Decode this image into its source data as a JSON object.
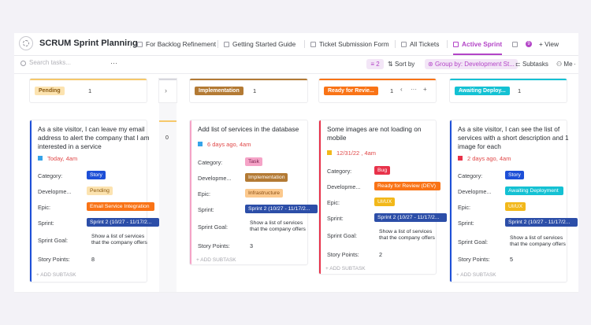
{
  "header": {
    "title": "SCRUM Sprint Planning",
    "tabs": [
      "For Backlog Refinement",
      "Getting Started Guide",
      "Ticket Submission Form",
      "All Tickets",
      "Active Sprint"
    ],
    "more_count": "9",
    "view_label": "+ View"
  },
  "toolbar": {
    "search_placeholder": "Search tasks...",
    "more": "···",
    "filter_count": "2",
    "sort_label": "Sort by",
    "group_label": "Group by: Development St...",
    "subtasks_label": "Subtasks",
    "me_label": "Me",
    "overflow": "·"
  },
  "colors": {
    "accent": "#b344c7",
    "pending": "#f6c86a",
    "implementation": "#b37a34",
    "ready": "#f97316",
    "awaiting": "#14c1d3",
    "story": "#1d4fd7",
    "bug": "#e8324a",
    "sprint": "#2c4ea8"
  },
  "columns": [
    {
      "name": "Pending",
      "count": "1"
    },
    {
      "name": "Implementation",
      "count": "1"
    },
    {
      "name": "Ready for Revie...",
      "count": "1"
    },
    {
      "name": "Awaiting Deploy...",
      "count": "1"
    }
  ],
  "collapsed_column": {
    "count": "0",
    "icon": "chevron-right-icon"
  },
  "labels": {
    "category": "Category:",
    "development": "Developme...",
    "epic": "Epic:",
    "sprint": "Sprint:",
    "sprint_goal": "Sprint Goal:",
    "story_points": "Story Points:",
    "add_subtask": "+ ADD SUBTASK",
    "col_more": "···",
    "col_add": "+",
    "col_collapse": "‹"
  },
  "cards": [
    {
      "title": "As a site visitor, I can leave my email address to alert the company that I am interested in a service",
      "due": "Today, 4am",
      "category": "Story",
      "development": "Pending",
      "epic": "Email Service Integration",
      "sprint": "Sprint 2 (10/27 - 11/17/2...",
      "sprint_goal": "Show a list of services that the company offers",
      "story_points": "8"
    },
    {
      "title": "Add list of services in the database",
      "due": "6 days ago, 4am",
      "category": "Task",
      "development": "Implementation",
      "epic": "Infrastructure",
      "sprint": "Sprint 2 (10/27 - 11/17/2...",
      "sprint_goal": "Show a list of services that the company offers",
      "story_points": "3"
    },
    {
      "title": "Some images are not loading on mobile",
      "due": "12/31/22 , 4am",
      "category": "Bug",
      "development": "Ready for Review (DEV)",
      "epic": "UI/UX",
      "sprint": "Sprint 2 (10/27 - 11/17/2...",
      "sprint_goal": "Show a list of services that the company offers",
      "story_points": "2"
    },
    {
      "title": "As a site visitor, I can see the list of services with a short description and 1 image for each",
      "due": "2 days ago, 4am",
      "category": "Story",
      "development": "Awaiting Deployment",
      "epic": "UI/UX",
      "sprint": "Sprint 2 (10/27 - 11/17/2...",
      "sprint_goal": "Show a list of services that the company offers",
      "story_points": "5"
    }
  ]
}
